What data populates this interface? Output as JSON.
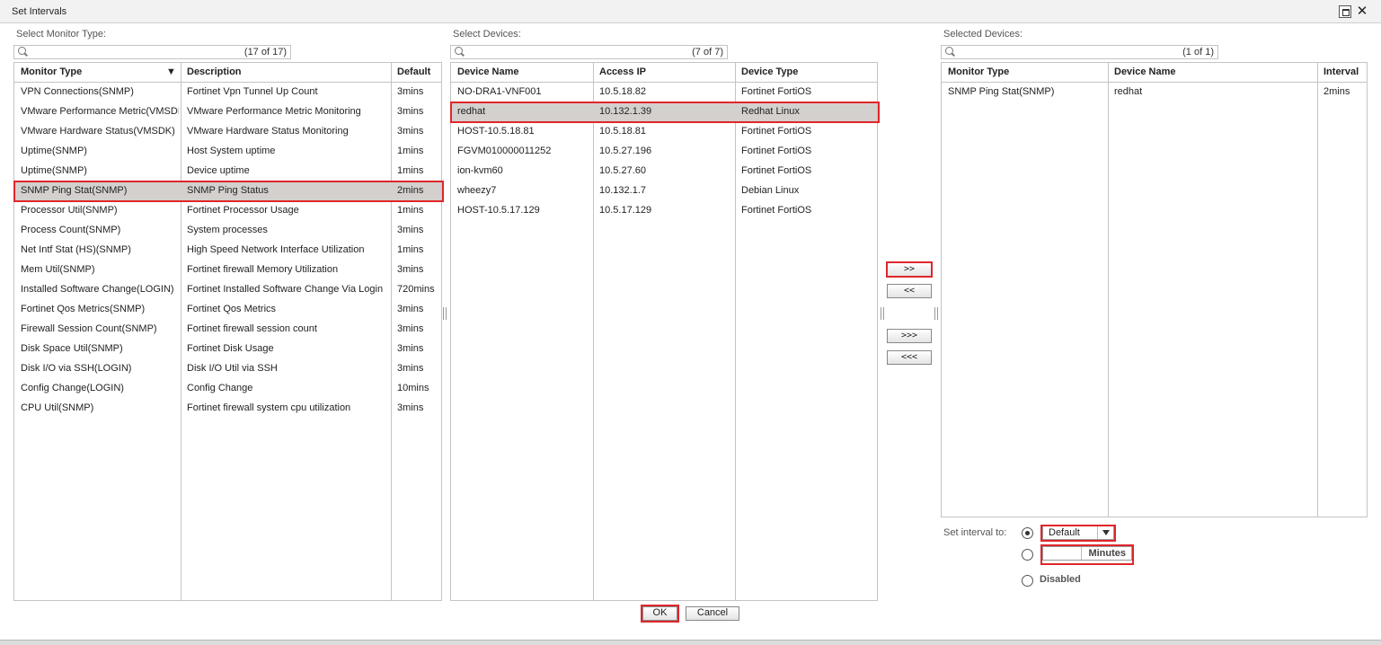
{
  "window": {
    "title": "Set Intervals",
    "maximize_icon": "maximize-icon",
    "close_icon": "close-icon",
    "close_glyph": "✕"
  },
  "colors": {
    "highlight": "#e0262b",
    "selected_row": "#d3d0cd"
  },
  "monitor_panel": {
    "label": "Select Monitor Type:",
    "search_count": "(17 of 17)",
    "columns": [
      "Monitor Type",
      "Description",
      "Default"
    ],
    "sort_indicator": "▼",
    "rows": [
      [
        "VPN Connections(SNMP)",
        "Fortinet Vpn Tunnel Up Count",
        "3mins"
      ],
      [
        "VMware Performance Metric(VMSDK)",
        "VMware Performance Metric Monitoring",
        "3mins"
      ],
      [
        "VMware Hardware Status(VMSDK)",
        "VMware Hardware Status Monitoring",
        "3mins"
      ],
      [
        "Uptime(SNMP)",
        "Host System uptime",
        "1mins"
      ],
      [
        "Uptime(SNMP)",
        "Device uptime",
        "1mins"
      ],
      [
        "SNMP Ping Stat(SNMP)",
        "SNMP Ping Status",
        "2mins"
      ],
      [
        "Processor Util(SNMP)",
        "Fortinet Processor Usage",
        "1mins"
      ],
      [
        "Process Count(SNMP)",
        "System processes",
        "3mins"
      ],
      [
        "Net Intf Stat (HS)(SNMP)",
        "High Speed Network Interface  Utilization",
        "1mins"
      ],
      [
        "Mem Util(SNMP)",
        "Fortinet firewall Memory  Utilization",
        "3mins"
      ],
      [
        "Installed Software Change(LOGIN)",
        "Fortinet Installed Software Change Via Login",
        "720mins"
      ],
      [
        "Fortinet Qos Metrics(SNMP)",
        "Fortinet Qos Metrics",
        "3mins"
      ],
      [
        "Firewall Session Count(SNMP)",
        "Fortinet firewall session count",
        "3mins"
      ],
      [
        "Disk Space Util(SNMP)",
        "Fortinet Disk Usage",
        "3mins"
      ],
      [
        "Disk I/O via SSH(LOGIN)",
        "Disk I/O Util via SSH",
        "3mins"
      ],
      [
        "Config Change(LOGIN)",
        "Config Change",
        "10mins"
      ],
      [
        "CPU Util(SNMP)",
        "Fortinet firewall system cpu utilization",
        "3mins"
      ]
    ],
    "selected_index": 5
  },
  "device_panel": {
    "label": "Select Devices:",
    "search_count": "(7 of 7)",
    "columns": [
      "Device Name",
      "Access IP",
      "Device Type"
    ],
    "rows": [
      [
        "NO-DRA1-VNF001",
        "10.5.18.82",
        "Fortinet FortiOS"
      ],
      [
        "redhat",
        "10.132.1.39",
        "Redhat Linux"
      ],
      [
        "HOST-10.5.18.81",
        "10.5.18.81",
        "Fortinet FortiOS"
      ],
      [
        "FGVM010000011252",
        "10.5.27.196",
        "Fortinet FortiOS"
      ],
      [
        "ion-kvm60",
        "10.5.27.60",
        "Fortinet FortiOS"
      ],
      [
        "wheezy7",
        "10.132.1.7",
        "Debian Linux"
      ],
      [
        "HOST-10.5.17.129",
        "10.5.17.129",
        "Fortinet FortiOS"
      ]
    ],
    "selected_index": 1
  },
  "transfer_buttons": {
    "add": ">>",
    "remove": "<<",
    "add_all": ">>>",
    "remove_all": "<<<"
  },
  "selected_panel": {
    "label": "Selected Devices:",
    "search_count": "(1 of 1)",
    "columns": [
      "Monitor Type",
      "Device Name",
      "Interval"
    ],
    "rows": [
      [
        "SNMP Ping Stat(SNMP)",
        "redhat",
        "2mins"
      ]
    ]
  },
  "interval": {
    "label": "Set interval to:",
    "default_value": "Default",
    "minutes_label": "Minutes",
    "minutes_value": "",
    "disabled_label": "Disabled",
    "selected_option": "default"
  },
  "footer": {
    "ok": "OK",
    "cancel": "Cancel"
  }
}
